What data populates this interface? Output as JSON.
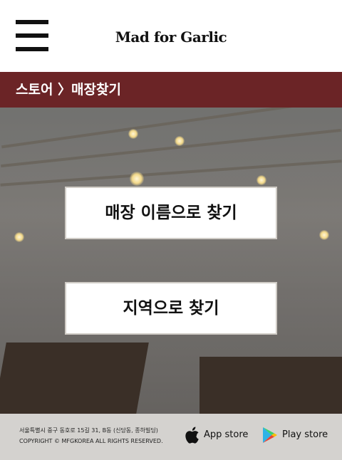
{
  "header": {
    "logo_text": "Mad for Garlic",
    "menu_icon": "hamburger-menu-icon"
  },
  "breadcrumb": {
    "text": "스토어 〉매장찾기"
  },
  "actions": {
    "find_by_name": "매장 이름으로 찾기",
    "find_by_region": "지역으로 찾기"
  },
  "footer": {
    "address": "서울특별시 중구 동호로 15길 31, B동 (신당동, 종하빌딩)",
    "copyright": "COPYRIGHT © MFGKOREA ALL RIGHTS RESERVED.",
    "app_store_label": "App store",
    "play_store_label": "Play store"
  },
  "colors": {
    "breadcrumb_bg": "#6b2426",
    "footer_bg": "#d4d2cf"
  }
}
